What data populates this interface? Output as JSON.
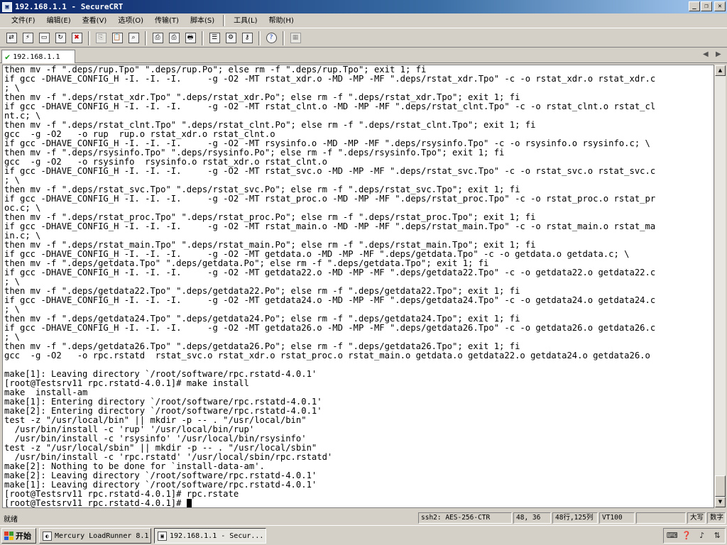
{
  "window": {
    "title": "192.168.1.1 - SecureCRT"
  },
  "menu": [
    "文件(F)",
    "编辑(E)",
    "查看(V)",
    "选项(O)",
    "传输(T)",
    "脚本(S)",
    "工具(L)",
    "帮助(H)"
  ],
  "tab": {
    "label": "192.168.1.1"
  },
  "terminal": {
    "lines": [
      "then mv -f \".deps/rup.Tpo\" \".deps/rup.Po\"; else rm -f \".deps/rup.Tpo\"; exit 1; fi",
      "if gcc -DHAVE_CONFIG_H -I. -I. -I.     -g -O2 -MT rstat_xdr.o -MD -MP -MF \".deps/rstat_xdr.Tpo\" -c -o rstat_xdr.o rstat_xdr.c",
      "; \\",
      "then mv -f \".deps/rstat_xdr.Tpo\" \".deps/rstat_xdr.Po\"; else rm -f \".deps/rstat_xdr.Tpo\"; exit 1; fi",
      "if gcc -DHAVE_CONFIG_H -I. -I. -I.     -g -O2 -MT rstat_clnt.o -MD -MP -MF \".deps/rstat_clnt.Tpo\" -c -o rstat_clnt.o rstat_cl",
      "nt.c; \\",
      "then mv -f \".deps/rstat_clnt.Tpo\" \".deps/rstat_clnt.Po\"; else rm -f \".deps/rstat_clnt.Tpo\"; exit 1; fi",
      "gcc  -g -O2   -o rup  rup.o rstat_xdr.o rstat_clnt.o",
      "if gcc -DHAVE_CONFIG_H -I. -I. -I.     -g -O2 -MT rsysinfo.o -MD -MP -MF \".deps/rsysinfo.Tpo\" -c -o rsysinfo.o rsysinfo.c; \\",
      "then mv -f \".deps/rsysinfo.Tpo\" \".deps/rsysinfo.Po\"; else rm -f \".deps/rsysinfo.Tpo\"; exit 1; fi",
      "gcc  -g -O2   -o rsysinfo  rsysinfo.o rstat_xdr.o rstat_clnt.o",
      "if gcc -DHAVE_CONFIG_H -I. -I. -I.     -g -O2 -MT rstat_svc.o -MD -MP -MF \".deps/rstat_svc.Tpo\" -c -o rstat_svc.o rstat_svc.c",
      "; \\",
      "then mv -f \".deps/rstat_svc.Tpo\" \".deps/rstat_svc.Po\"; else rm -f \".deps/rstat_svc.Tpo\"; exit 1; fi",
      "if gcc -DHAVE_CONFIG_H -I. -I. -I.     -g -O2 -MT rstat_proc.o -MD -MP -MF \".deps/rstat_proc.Tpo\" -c -o rstat_proc.o rstat_pr",
      "oc.c; \\",
      "then mv -f \".deps/rstat_proc.Tpo\" \".deps/rstat_proc.Po\"; else rm -f \".deps/rstat_proc.Tpo\"; exit 1; fi",
      "if gcc -DHAVE_CONFIG_H -I. -I. -I.     -g -O2 -MT rstat_main.o -MD -MP -MF \".deps/rstat_main.Tpo\" -c -o rstat_main.o rstat_ma",
      "in.c; \\",
      "then mv -f \".deps/rstat_main.Tpo\" \".deps/rstat_main.Po\"; else rm -f \".deps/rstat_main.Tpo\"; exit 1; fi",
      "if gcc -DHAVE_CONFIG_H -I. -I. -I.     -g -O2 -MT getdata.o -MD -MP -MF \".deps/getdata.Tpo\" -c -o getdata.o getdata.c; \\",
      "then mv -f \".deps/getdata.Tpo\" \".deps/getdata.Po\"; else rm -f \".deps/getdata.Tpo\"; exit 1; fi",
      "if gcc -DHAVE_CONFIG_H -I. -I. -I.     -g -O2 -MT getdata22.o -MD -MP -MF \".deps/getdata22.Tpo\" -c -o getdata22.o getdata22.c",
      "; \\",
      "then mv -f \".deps/getdata22.Tpo\" \".deps/getdata22.Po\"; else rm -f \".deps/getdata22.Tpo\"; exit 1; fi",
      "if gcc -DHAVE_CONFIG_H -I. -I. -I.     -g -O2 -MT getdata24.o -MD -MP -MF \".deps/getdata24.Tpo\" -c -o getdata24.o getdata24.c",
      "; \\",
      "then mv -f \".deps/getdata24.Tpo\" \".deps/getdata24.Po\"; else rm -f \".deps/getdata24.Tpo\"; exit 1; fi",
      "if gcc -DHAVE_CONFIG_H -I. -I. -I.     -g -O2 -MT getdata26.o -MD -MP -MF \".deps/getdata26.Tpo\" -c -o getdata26.o getdata26.c",
      "; \\",
      "then mv -f \".deps/getdata26.Tpo\" \".deps/getdata26.Po\"; else rm -f \".deps/getdata26.Tpo\"; exit 1; fi",
      "gcc  -g -O2   -o rpc.rstatd  rstat_svc.o rstat_xdr.o rstat_proc.o rstat_main.o getdata.o getdata22.o getdata24.o getdata26.o",
      "",
      "make[1]: Leaving directory `/root/software/rpc.rstatd-4.0.1'",
      "[root@Testsrv11 rpc.rstatd-4.0.1]# make install",
      "make  install-am",
      "make[1]: Entering directory `/root/software/rpc.rstatd-4.0.1'",
      "make[2]: Entering directory `/root/software/rpc.rstatd-4.0.1'",
      "test -z \"/usr/local/bin\" || mkdir -p -- . \"/usr/local/bin\"",
      "  /usr/bin/install -c 'rup' '/usr/local/bin/rup'",
      "  /usr/bin/install -c 'rsysinfo' '/usr/local/bin/rsysinfo'",
      "test -z \"/usr/local/sbin\" || mkdir -p -- . \"/usr/local/sbin\"",
      "  /usr/bin/install -c 'rpc.rstatd' '/usr/local/sbin/rpc.rstatd'",
      "make[2]: Nothing to be done for `install-data-am'.",
      "make[2]: Leaving directory `/root/software/rpc.rstatd-4.0.1'",
      "make[1]: Leaving directory `/root/software/rpc.rstatd-4.0.1'",
      "[root@Testsrv11 rpc.rstatd-4.0.1]# rpc.rstate",
      "[root@Testsrv11 rpc.rstatd-4.0.1]#"
    ]
  },
  "status": {
    "ready": "就绪",
    "cipher": "ssh2: AES-256-CTR",
    "cursor_pos": "48,  36",
    "size": "48行,125列",
    "term_type": "VT100",
    "caps": "大写",
    "num": "数字"
  },
  "taskbar": {
    "start": "开始",
    "tasks": [
      "Mercury LoadRunner 8.1",
      "192.168.1.1 - Secur..."
    ]
  },
  "colors": {
    "title_gradient_start": "#0a246a",
    "title_gradient_end": "#a6caf0",
    "chrome": "#d4d0c8",
    "terminal_bg": "#ffffff",
    "terminal_fg": "#000000"
  }
}
